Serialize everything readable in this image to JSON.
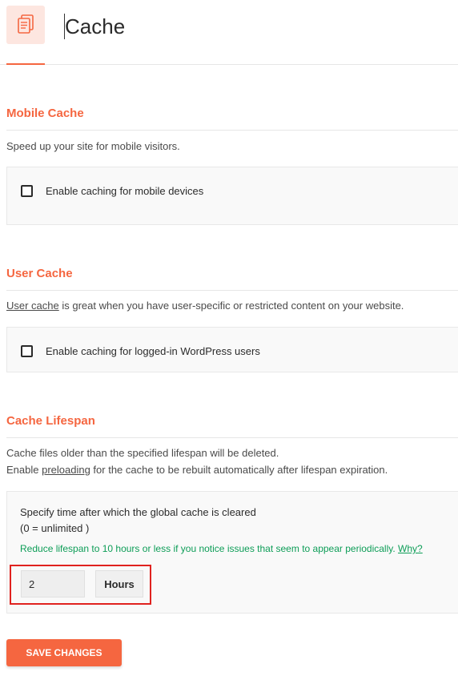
{
  "header": {
    "title": "Cache",
    "icon": "document-copy-icon"
  },
  "mobile_cache": {
    "title": "Mobile Cache",
    "description": "Speed up your site for mobile visitors.",
    "checkbox_label": "Enable caching for mobile devices",
    "checked": false
  },
  "user_cache": {
    "title": "User Cache",
    "description_link": "User cache",
    "description_rest": " is great when you have user-specific or restricted content on your website.",
    "checkbox_label": "Enable caching for logged-in WordPress users",
    "checked": false
  },
  "cache_lifespan": {
    "title": "Cache Lifespan",
    "description_line1": "Cache files older than the specified lifespan will be deleted.",
    "description_line2_pre": "Enable ",
    "description_line2_link": "preloading",
    "description_line2_post": " for the cache to be rebuilt automatically after lifespan expiration.",
    "question_line1": "Specify time after which the global cache is cleared",
    "question_line2": "(0 = unlimited )",
    "hint": "Reduce lifespan to 10 hours or less if you notice issues that seem to appear periodically. ",
    "hint_link": "Why?",
    "value": "2",
    "unit": "Hours"
  },
  "save_button": "SAVE CHANGES",
  "colors": {
    "accent": "#f56640",
    "hint_green": "#0d9d57",
    "highlight_red": "#e0221f"
  }
}
